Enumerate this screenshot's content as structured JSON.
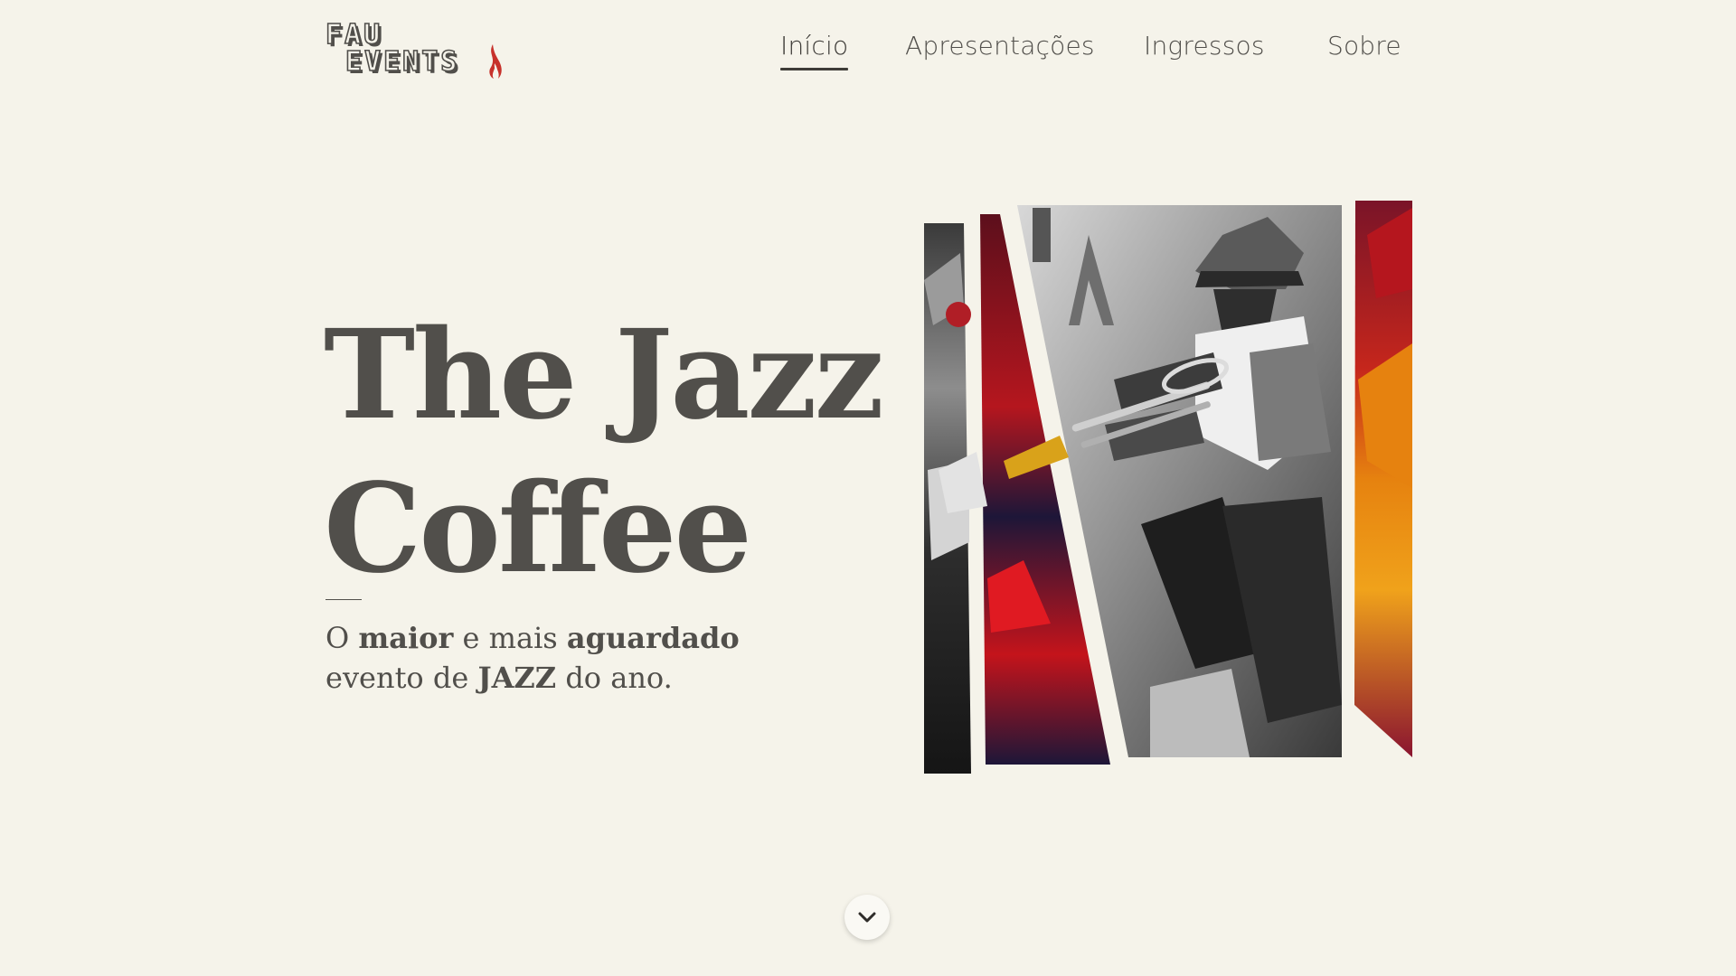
{
  "brand": {
    "line1": "FAU",
    "line2": "EVENTS",
    "flame_color": "#c7312b"
  },
  "nav": {
    "items": [
      {
        "label": "Início",
        "active": true
      },
      {
        "label": "Apresentações",
        "active": false
      },
      {
        "label": "Ingressos",
        "active": false
      },
      {
        "label": "Sobre",
        "active": false
      }
    ]
  },
  "hero": {
    "title_line1": "The Jazz",
    "title_line2": "Coffee",
    "subtitle": {
      "part1": "O ",
      "bold1": "maior",
      "part2": " e mais ",
      "bold2": "aguardado",
      "part3": " evento de ",
      "bold3": "JAZZ",
      "part4": " do ano."
    }
  },
  "art": {
    "subject": "jazz trumpet player painting",
    "colors": {
      "red": "#b5161e",
      "navy": "#1d1638",
      "orange": "#e6820f",
      "gold": "#d9a21a"
    }
  },
  "scroll_button": {
    "icon": "chevron-down-icon"
  },
  "colors": {
    "background": "#f5f3ea",
    "text": "#514f4b"
  }
}
